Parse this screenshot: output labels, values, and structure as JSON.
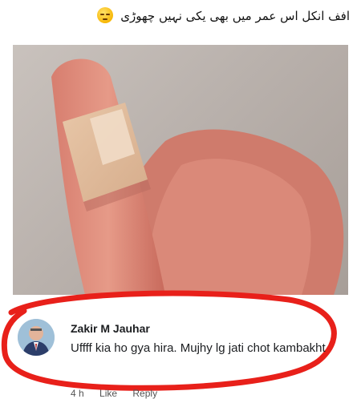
{
  "post": {
    "caption": "افف انکل اس عمر میں بھی یکی نہیں چھوڑی",
    "emoji_icon": "unamused-face-icon"
  },
  "comment": {
    "author": "Zakir M Jauhar",
    "text": "Uffff kia ho gya hira. Mujhy lg jati chot kambakht",
    "time": "4 h",
    "like_label": "Like",
    "reply_label": "Reply"
  },
  "colors": {
    "annotation_red": "#e8201a",
    "text": "#1c1e21"
  }
}
